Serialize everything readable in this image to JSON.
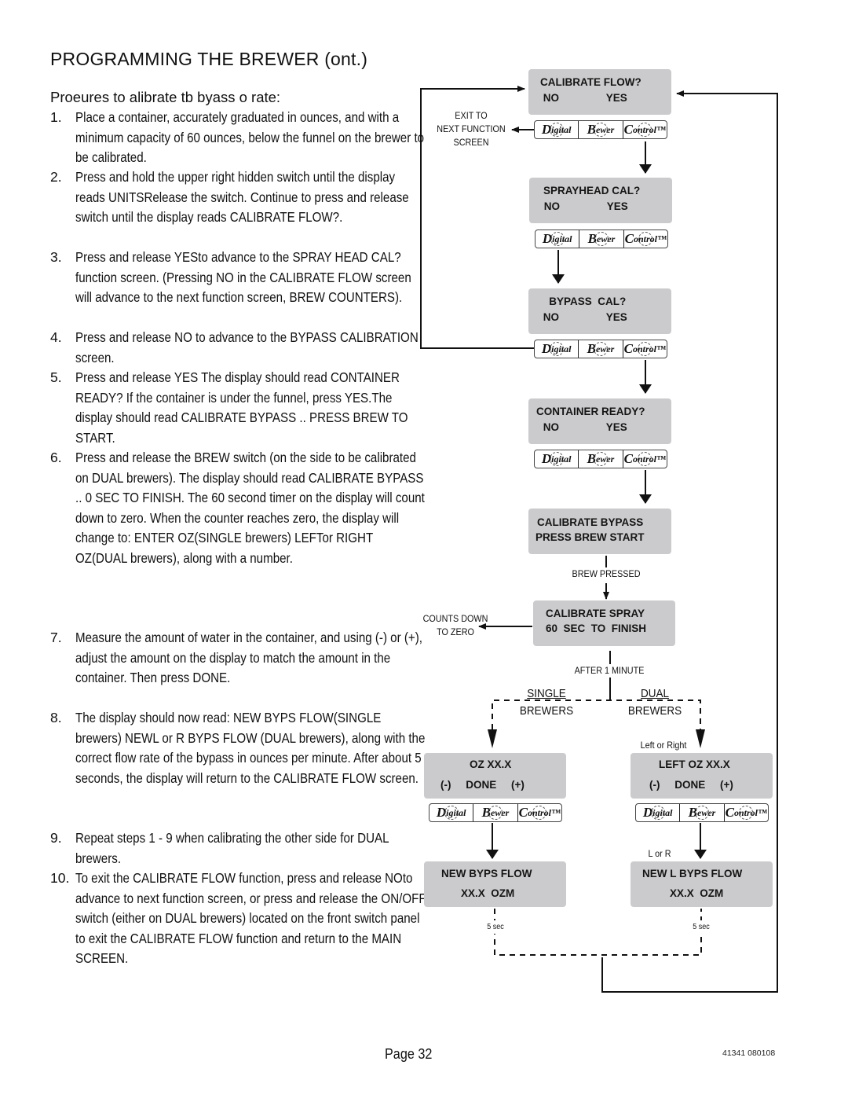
{
  "page": {
    "title": "PROGRAMMING THE BREWER (ont.)",
    "subtitle": "Proeures to alibrate tb byass o rate:",
    "steps": [
      {
        "num": "1.",
        "text": "Place a container, accurately graduated in ounces, and with a minimum capacity of 60 ounces, below the funnel on the brewer to be calibrated."
      },
      {
        "num": "2.",
        "text": "Press and hold the upper right hidden switch until the display reads UNITSRelease the switch. Continue to press and release switch until the display reads CALIBRATE FLOW?."
      },
      {
        "num": "3.",
        "text": "Press and release YESto advance to the SPRAY HEAD CAL? function screen. (Pressing NO in the CALIBRATE FLOW screen will advance to the next function screen, BREW COUNTERS)."
      },
      {
        "num": "4.",
        "text": "Press and release NO to advance to the BYPASS CALIBRATION screen."
      },
      {
        "num": "5.",
        "text": "Press and release YES The display should read CONTAINER READY? If the container is under the funnel, press YES.The display should read CALIBRATE BYPASS .. PRESS BREW TO START."
      },
      {
        "num": "6.",
        "text": "Press and release the BREW switch (on the side to be calibrated on DUAL brewers). The display should read CALIBRATE BYPASS .. 0 SEC TO FINISH. The 60 second timer on the display will count down to zero. When the counter reaches zero, the display will change to: ENTER OZ(SINGLE brewers) LEFTor RIGHT OZ(DUAL brewers), along with a number."
      },
      {
        "num": "7.",
        "text": "Measure the amount of water in the container, and using (-) or (+), adjust the amount on the display to match the amount in the container. Then press DONE."
      },
      {
        "num": "8.",
        "text": "The display should now read: NEW BYPS FLOW(SINGLE brewers) NEWL or R BYPS FLOW (DUAL brewers), along with the correct flow rate of the bypass in ounces per minute. After about 5 seconds, the display will return to the CALIBRATE FLOW screen."
      },
      {
        "num": "9.",
        "text": "Repeat steps 1 - 9 when calibrating the other side for DUAL brewers."
      },
      {
        "num": "10.",
        "text": "To exit the CALIBRATE FLOW function, press and release NOto advance to next function screen, or press and release the ON/OFF switch (either on DUAL brewers) located on the front switch panel to exit the CALIBRATE FLOW function and return to the MAIN SCREEN."
      }
    ],
    "footer": {
      "page": "Page 32",
      "code": "41341 080108"
    }
  },
  "diagram": {
    "panels": {
      "calibrate_flow": {
        "line1": "CALIBRATE FLOW?",
        "line2": " NO                YES"
      },
      "sprayhead_cal": {
        "line1": "SPRAYHEAD CAL?",
        "line2": " NO                YES"
      },
      "bypass_cal": {
        "line1": "   BYPASS  CAL?",
        "line2": " NO                YES"
      },
      "container_ready": {
        "line1": "CONTAINER READY?",
        "line2": " NO                YES"
      },
      "calibrate_bypass": {
        "line1": "CALIBRATE BYPASS",
        "line2": "PRESS BREW START"
      },
      "calibrate_spray": {
        "line1": "CALIBRATE SPRAY",
        "line2": "60  SEC  TO  FINISH"
      },
      "oz_single": {
        "line1": "OZ XX.X",
        "line2": "(-)     DONE     (+)"
      },
      "oz_dual": {
        "line1": "LEFT OZ XX.X",
        "line2": "(-)     DONE     (+)"
      },
      "new_flow_single": {
        "line1": "NEW BYPS FLOW",
        "line2": "XX.X  OZM"
      },
      "new_flow_dual": {
        "line1": "NEW L BYPS FLOW",
        "line2": "XX.X  OZM"
      }
    },
    "logo": {
      "seg1": "igital",
      "seg1_cap": "D",
      "seg2": "ewer",
      "seg2_cap": "B",
      "seg3": "ontrol™",
      "seg3_cap": "C"
    },
    "labels": {
      "exit_to": "EXIT TO",
      "next_function": "NEXT FUNCTION",
      "screen": "SCREEN",
      "brew_pressed": "BREW PRESSED",
      "counts_down": "COUNTS DOWN",
      "to_zero": "TO ZERO",
      "after_minute": "AFTER 1 MINUTE",
      "single": "SINGLE",
      "dual": "DUAL",
      "brewers_single": "BREWERS",
      "brewers_dual": "BREWERS",
      "left_or_right": "Left or Right",
      "l_or_r": "L or R",
      "five_sec_single": "5 sec",
      "five_sec_dual": "5 sec"
    },
    "colors": {
      "panel": "#cbcbcd",
      "line": "#111111"
    }
  }
}
